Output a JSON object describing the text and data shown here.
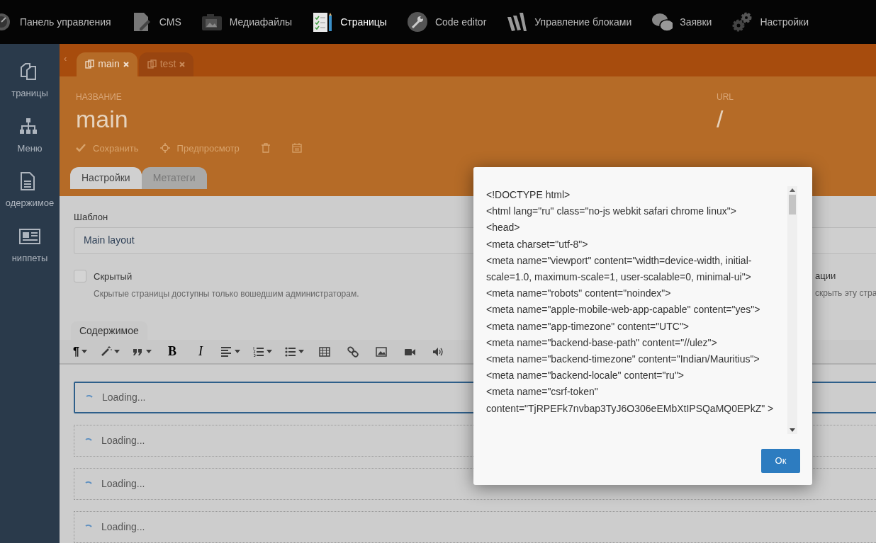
{
  "top_nav": [
    {
      "label": "Панель управления",
      "kind": "gauge",
      "selected": false
    },
    {
      "label": "CMS",
      "kind": "edit-doc",
      "selected": false
    },
    {
      "label": "Медиафайлы",
      "kind": "camera",
      "selected": false
    },
    {
      "label": "Страницы",
      "kind": "checklist",
      "selected": true
    },
    {
      "label": "Code editor",
      "kind": "wrench",
      "selected": false
    },
    {
      "label": "Управление блоками",
      "kind": "blocks",
      "selected": false
    },
    {
      "label": "Заявки",
      "kind": "chat",
      "selected": false
    },
    {
      "label": "Настройки",
      "kind": "gears",
      "selected": false
    }
  ],
  "sidebar": {
    "items": [
      {
        "label": "траницы",
        "kind": "pages"
      },
      {
        "label": "Меню",
        "kind": "sitemap"
      },
      {
        "label": "одержимое",
        "kind": "document"
      },
      {
        "label": "ниппеты",
        "kind": "newspaper"
      }
    ]
  },
  "back_arrow": "‹",
  "doc_tabs": [
    {
      "label": "main",
      "selected": true
    },
    {
      "label": "test",
      "selected": false
    }
  ],
  "header": {
    "name_label": "НАЗВАНИЕ",
    "name": "main",
    "url_label": "URL",
    "url": "/",
    "actions": [
      {
        "label": "Сохранить",
        "kind": "check"
      },
      {
        "label": "Предпросмотр",
        "kind": "move"
      },
      {
        "kind": "trash"
      },
      {
        "kind": "calendar"
      }
    ]
  },
  "form_tabs": [
    {
      "label": "Настройки",
      "selected": true
    },
    {
      "label": "Метатеги",
      "selected": false
    }
  ],
  "template": {
    "label": "Шаблон",
    "value": "Main layout"
  },
  "hidden": {
    "label": "Скрытый",
    "checked": false,
    "hint": "Скрытые страницы доступны только вошедшим администраторам."
  },
  "right_partial": {
    "label": "ации",
    "hint": "скрыть эту стра"
  },
  "content_tab": "Содержимое",
  "toolbar": [
    {
      "kind": "glyph",
      "text": "¶",
      "dropdown": true
    },
    {
      "kind": "magic",
      "dropdown": true
    },
    {
      "kind": "quote",
      "dropdown": true
    },
    {
      "kind": "bold",
      "text": "B",
      "dropdown": false
    },
    {
      "kind": "italic",
      "text": "I",
      "dropdown": false
    },
    {
      "kind": "align",
      "dropdown": true
    },
    {
      "kind": "ol",
      "dropdown": true
    },
    {
      "kind": "ul",
      "dropdown": true
    },
    {
      "kind": "table",
      "dropdown": false
    },
    {
      "kind": "link",
      "dropdown": false
    },
    {
      "kind": "image",
      "dropdown": false
    },
    {
      "kind": "video",
      "dropdown": false
    },
    {
      "kind": "audio",
      "dropdown": false
    }
  ],
  "blocks": [
    {
      "text": "Loading...",
      "selected": true
    },
    {
      "text": "Loading...",
      "selected": false
    },
    {
      "text": "Loading...",
      "selected": false
    },
    {
      "text": "Loading...",
      "selected": false
    }
  ],
  "dialog": {
    "lines": [
      "<!DOCTYPE html>",
      "<html lang=\"ru\" class=\"no-js webkit safari chrome linux\">",
      "<head>",
      "<meta charset=\"utf-8\">",
      "<meta name=\"viewport\" content=\"width=device-width, initial-scale=1.0, maximum-scale=1, user-scalable=0, minimal-ui\">",
      "<meta name=\"robots\" content=\"noindex\">",
      "<meta name=\"apple-mobile-web-app-capable\" content=\"yes\">",
      "<meta name=\"app-timezone\" content=\"UTC\">",
      "<meta name=\"backend-base-path\" content=\"//ulez\">",
      "<meta name=\"backend-timezone\" content=\"Indian/Mauritius\">",
      "<meta name=\"backend-locale\" content=\"ru\">",
      "<meta name=\"csrf-token\" content=\"TjRPEFk7nvbap3TyJ6O306eEMbXtIPSQaMQ0EPkZ\" >"
    ],
    "button": "Ок"
  }
}
